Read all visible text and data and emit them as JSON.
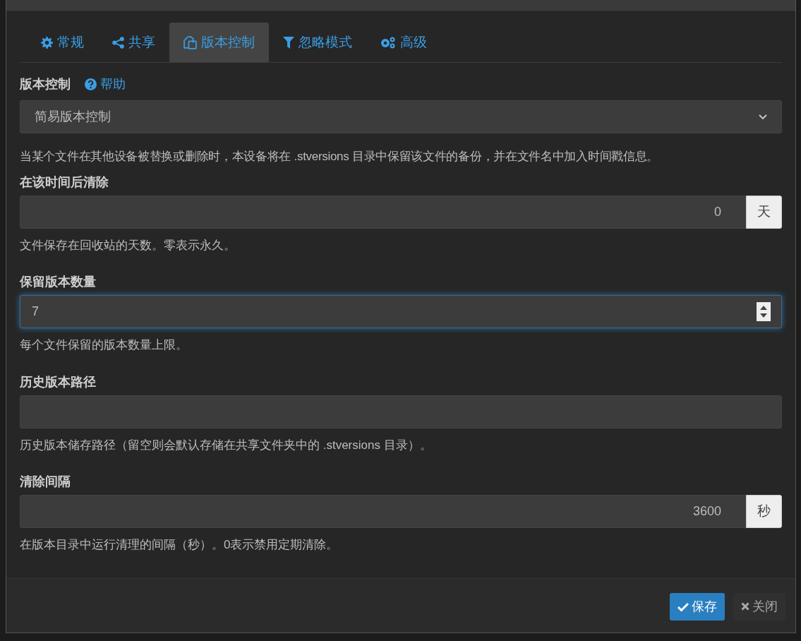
{
  "tabs": [
    {
      "label": "常规",
      "selected": false
    },
    {
      "label": "共享",
      "selected": false
    },
    {
      "label": "版本控制",
      "selected": true
    },
    {
      "label": "忽略模式",
      "selected": false
    },
    {
      "label": "高级",
      "selected": false
    }
  ],
  "versioning": {
    "label": "版本控制",
    "help_link": "帮助",
    "value": "简易版本控制",
    "description": "当某个文件在其他设备被替换或删除时，本设备将在 .stversions 目录中保留该文件的备份，并在文件名中加入时间戳信息。"
  },
  "fields": [
    {
      "kind": "addon",
      "label": "在该时间后清除",
      "value": "0",
      "addon": "天",
      "focused": false,
      "description": "文件保存在回收站的天数。零表示永久。"
    },
    {
      "kind": "spinner",
      "label": "保留版本数量",
      "value": "7",
      "focused": true,
      "description": "每个文件保留的版本数量上限。"
    },
    {
      "kind": "text",
      "label": "历史版本路径",
      "focused": false,
      "description": "历史版本储存路径（留空则会默认存储在共享文件夹中的 .stversions 目录）。"
    },
    {
      "kind": "addon",
      "label": "清除间隔",
      "value": "3600",
      "addon": "秒",
      "focused": false,
      "description": "在版本目录中运行清理的间隔（秒）。0表示禁用定期清除。"
    }
  ],
  "buttons": [
    {
      "kind": "primary",
      "label": "保存"
    },
    {
      "kind": "close",
      "label": "关闭"
    }
  ]
}
